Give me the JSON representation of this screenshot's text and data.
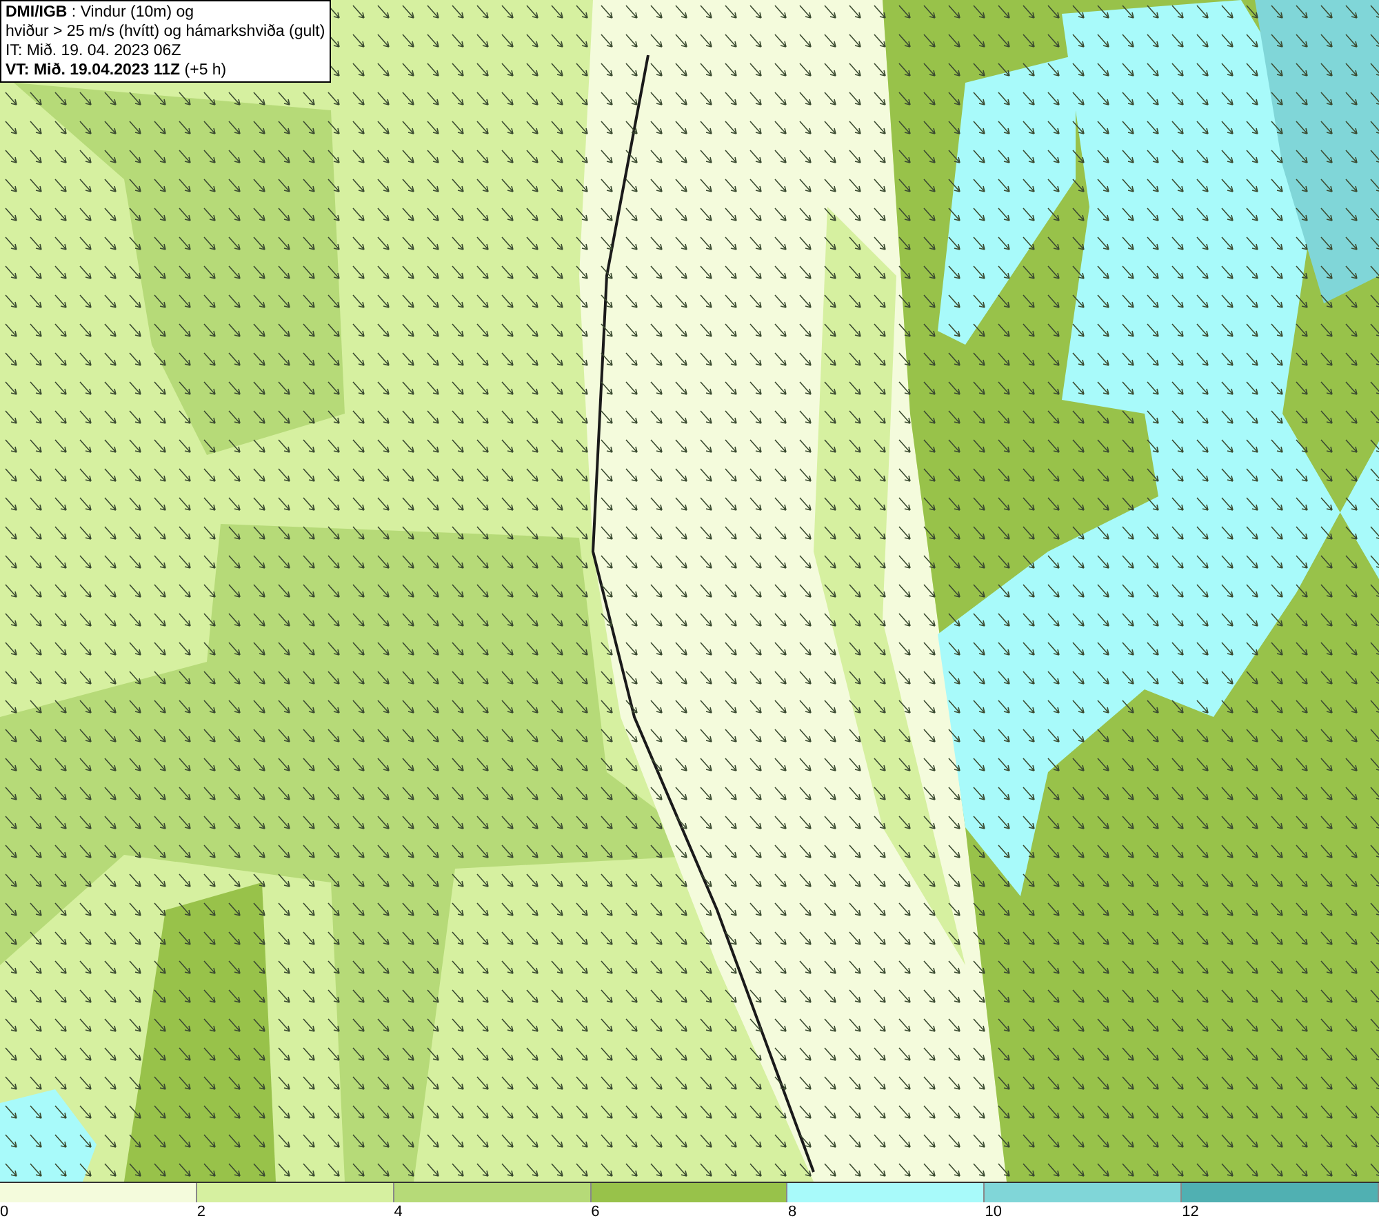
{
  "header": {
    "lines": [
      "**DMI/IGB** : Vindur (10m) og",
      "hviður > 25 m/s (hvítt) og hámarkshviða (gult)",
      "IT: Mið. 19. 04. 2023 06Z",
      "**VT: Mið. 19.04.2023 11Z** (+5 h)"
    ]
  },
  "legend": {
    "bins": [
      {
        "label": "0",
        "color": "#f4fbdc"
      },
      {
        "label": "2",
        "color": "#d6f0a0"
      },
      {
        "label": "4",
        "color": "#b6da78"
      },
      {
        "label": "6",
        "color": "#98c24a"
      },
      {
        "label": "8",
        "color": "#a8fafa"
      },
      {
        "label": "10",
        "color": "#80d6d8"
      },
      {
        "label": "12",
        "color": "#50b0b2"
      }
    ]
  }
}
